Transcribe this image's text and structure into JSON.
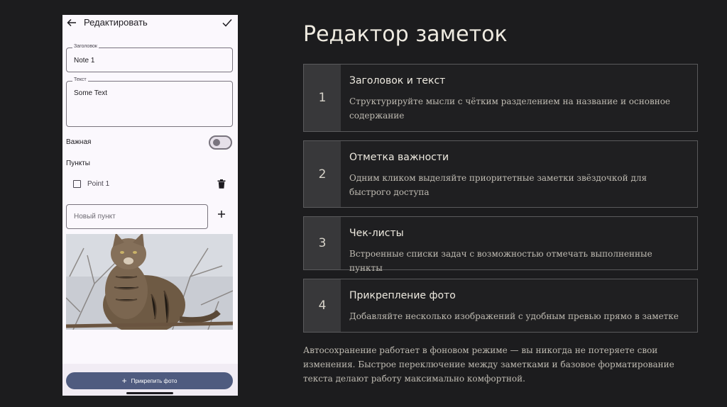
{
  "phone": {
    "topbar": {
      "title": "Редактировать"
    },
    "title_field": {
      "label": "Заголовок",
      "value": "Note 1"
    },
    "text_field": {
      "label": "Текст",
      "value": "Some Text"
    },
    "important": {
      "label": "Важная",
      "toggle_on": false
    },
    "points": {
      "label": "Пункты",
      "items": [
        {
          "text": "Point 1",
          "checked": false
        }
      ],
      "new_item_placeholder": "Новый пункт"
    },
    "attach_button": {
      "label": "Прикрепить фото"
    }
  },
  "slide": {
    "title": "Редактор заметок",
    "cards": [
      {
        "number": "1",
        "title": "Заголовок и текст",
        "description": "Структурируйте мысли с чётким разделением на название и основное содержание"
      },
      {
        "number": "2",
        "title": "Отметка важности",
        "description": "Одним кликом выделяйте приоритетные заметки звёздочкой для быстрого доступа"
      },
      {
        "number": "3",
        "title": "Чек-листы",
        "description": "Встроенные списки задач с возможностью отмечать выполненные пункты"
      },
      {
        "number": "4",
        "title": "Прикрепление фото",
        "description": "Добавляйте несколько изображений с удобным превью прямо в заметке"
      }
    ],
    "footer": "Автосохранение работает в фоновом режиме — вы никогда не потеряете свои изменения. Быстрое переключение между заметками и базовое форматирование текста делают работу максимально комфортной."
  },
  "colors": {
    "background": "#1c1c1e",
    "phone_surface": "#fbf8fd",
    "primary_button": "#4f5b7f",
    "card_number_bg": "#38383a"
  },
  "icons": [
    "arrow-back-icon",
    "check-icon",
    "trash-icon",
    "plus-icon"
  ]
}
